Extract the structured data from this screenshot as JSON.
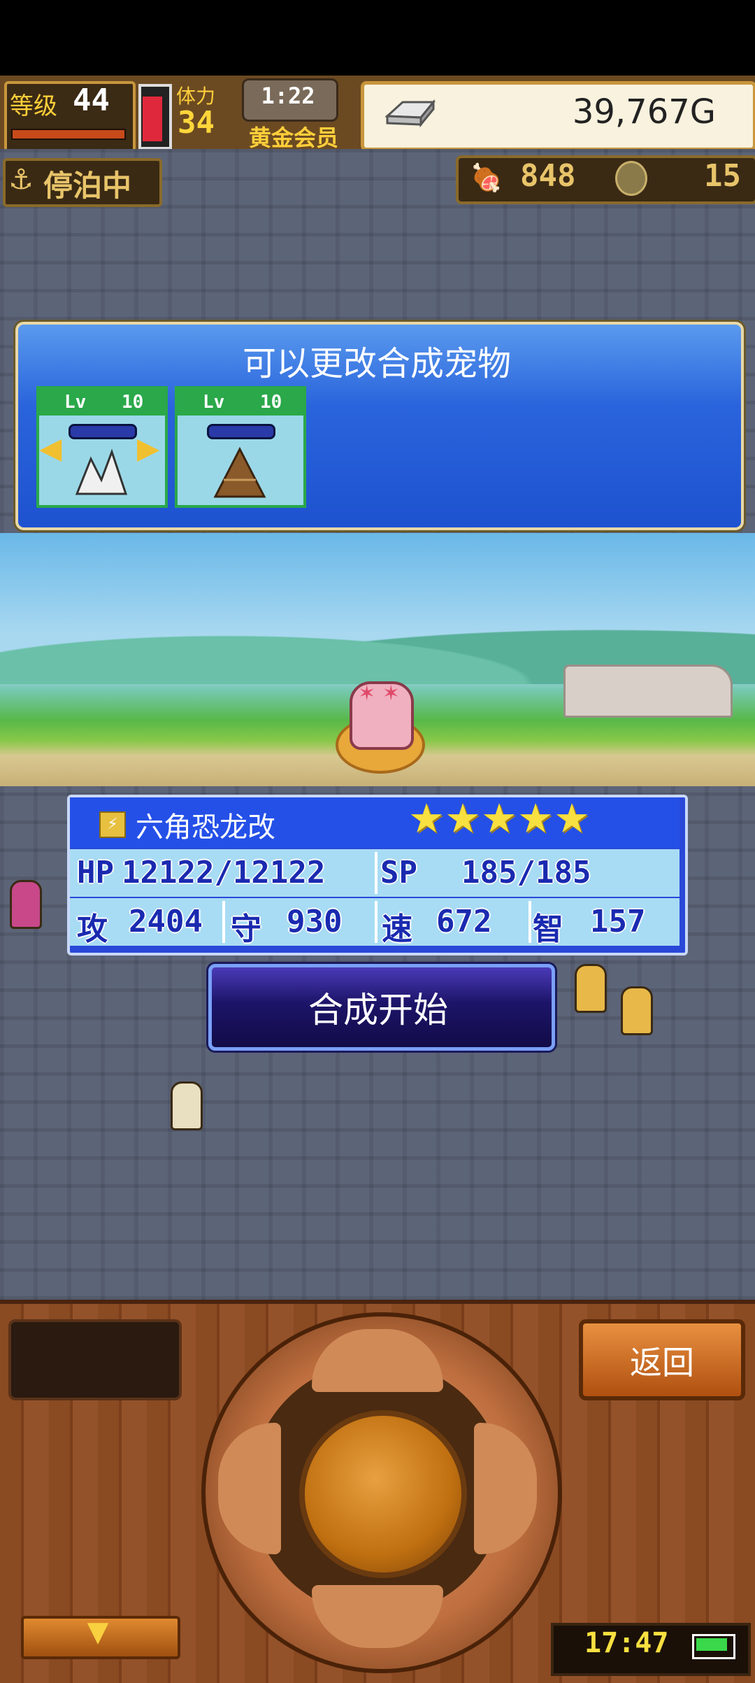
{
  "hud": {
    "level_label": "等级",
    "level_value": "44",
    "stamina_label": "体力",
    "stamina_value": "34",
    "timer": "1:22",
    "membership": "黄金会员",
    "gold": "39,767G"
  },
  "status_row": {
    "docked_label": "停泊中",
    "food_value": "848",
    "coin_value": "15"
  },
  "pet_panel": {
    "title": "可以更改合成宠物",
    "cards": [
      {
        "lv_label": "Lv",
        "lv_value": "10"
      },
      {
        "lv_label": "Lv",
        "lv_value": "10"
      }
    ]
  },
  "stats": {
    "pet_name": "六角恐龙改",
    "stars": 5,
    "hp_label": "HP",
    "hp_value": "12122/12122",
    "sp_label": "SP",
    "sp_value": "185/185",
    "atk_label": "攻",
    "atk_value": "2404",
    "def_label": "守",
    "def_value": "930",
    "spd_label": "速",
    "spd_value": "672",
    "int_label": "智",
    "int_value": "157"
  },
  "synth_button_label": "合成开始",
  "controller": {
    "back_label": "返回",
    "clock": "17:47"
  },
  "colors": {
    "panel_blue": "#2a64dc",
    "gold_accent": "#c8963c",
    "button_orange": "#e89040"
  }
}
